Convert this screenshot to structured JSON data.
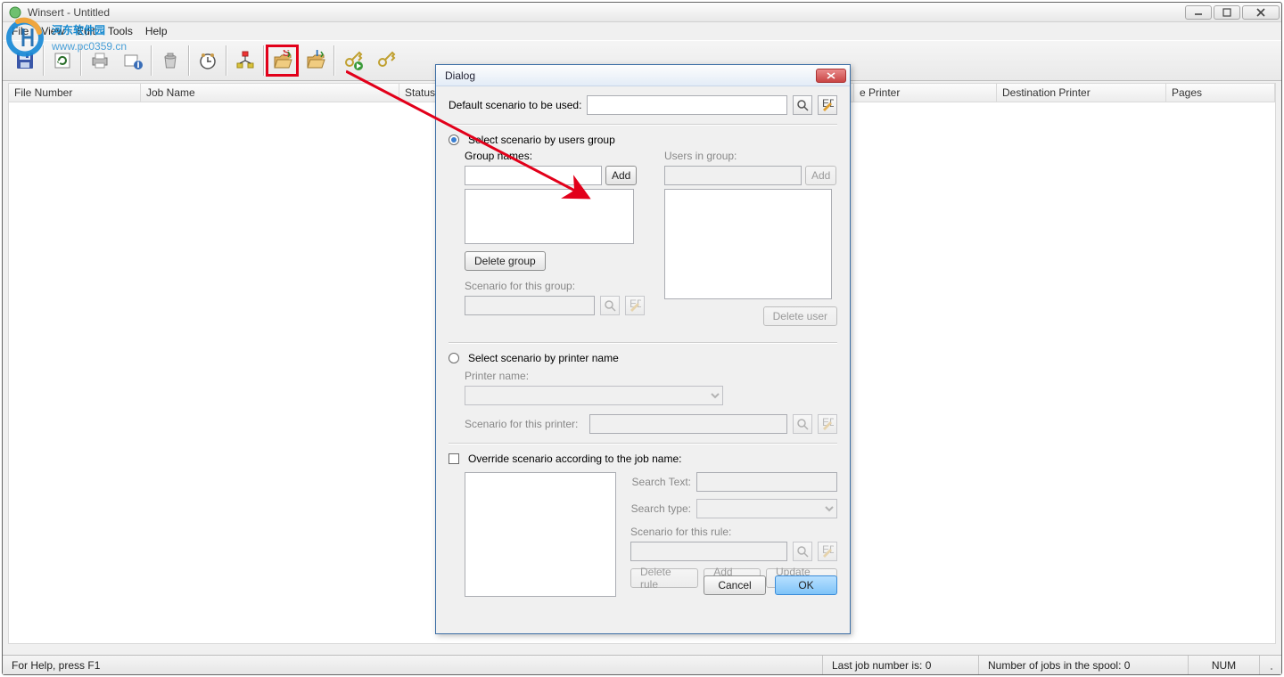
{
  "window": {
    "title": "Winsert - Untitled",
    "menus": [
      "File",
      "View",
      "Edit",
      "Tools",
      "Help"
    ]
  },
  "toolbar": {
    "buttons": [
      "save-icon",
      "refresh-icon",
      "print-icon",
      "info-icon",
      "trash-icon",
      "clock-icon",
      "flow-icon",
      "scenario-open-icon",
      "scenario-open2-icon",
      "key-play-icon",
      "key-icon"
    ]
  },
  "columns": {
    "file_number": "File Number",
    "job_name": "Job Name",
    "status": "Status",
    "e_printer": "e Printer",
    "dest_printer": "Destination Printer",
    "pages": "Pages"
  },
  "statusbar": {
    "hint": "For Help, press F1",
    "last_job": "Last job number is: 0",
    "spool": "Number of jobs in the spool: 0",
    "num": "NUM"
  },
  "dialog": {
    "title": "Dialog",
    "default_scenario_label": "Default scenario to be used:",
    "radio_users_group": "Select scenario by users group",
    "group_names_label": "Group names:",
    "add_btn": "Add",
    "users_in_group_label": "Users in group:",
    "delete_group_btn": "Delete group",
    "scenario_for_group_label": "Scenario for this group:",
    "delete_user_btn": "Delete user",
    "radio_printer": "Select scenario by printer name",
    "printer_name_label": "Printer name:",
    "scenario_for_printer_label": "Scenario for this printer:",
    "override_check": "Override scenario according to the job name:",
    "search_text_label": "Search Text:",
    "search_type_label": "Search type:",
    "scenario_for_rule_label": "Scenario for this rule:",
    "delete_rule_btn": "Delete rule",
    "add_rule_btn": "Add rule",
    "update_rule_btn": "Update rule",
    "cancel_btn": "Cancel",
    "ok_btn": "OK"
  },
  "watermark": {
    "brand_cn": "河东软件园",
    "url": "www.pc0359.cn"
  },
  "colors": {
    "highlight_red": "#e2001a",
    "primary_blue": "#7fc4f8"
  }
}
